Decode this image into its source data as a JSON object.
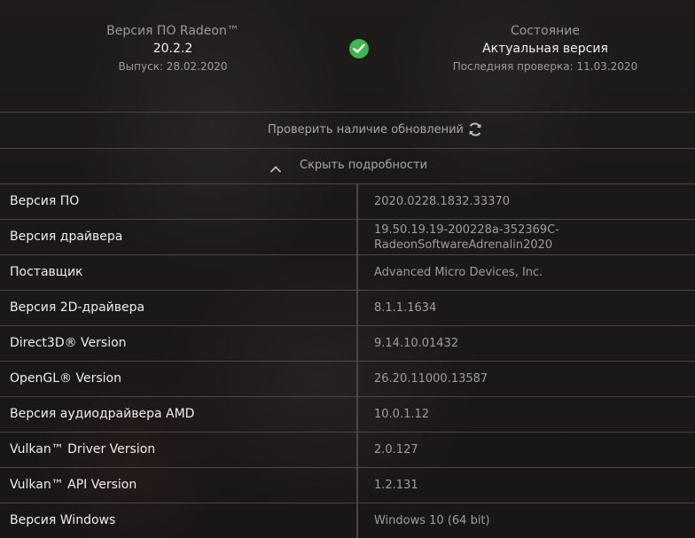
{
  "header": {
    "version_title": "Версия ПО Radeon™",
    "version_number": "20.2.2",
    "release_date": "Выпуск: 28.02.2020",
    "state_title": "Состояние",
    "state_value": "Актуальная версия",
    "last_check": "Последняя проверка: 11.03.2020",
    "status_color": "#3db551"
  },
  "actions": {
    "check_updates_label": "Проверить наличие обновлений",
    "hide_details_label": "Скрыть подробности"
  },
  "details": [
    {
      "key": "Версия ПО",
      "value": "2020.0228.1832.33370"
    },
    {
      "key": "Версия драйвера",
      "value_line1": "19.50.19.19-200228a-352369C-",
      "value_line2": "RadeonSoftwareAdrenalin2020"
    },
    {
      "key": "Поставщик",
      "value": "Advanced Micro Devices, Inc."
    },
    {
      "key": "Версия 2D-драйвера",
      "value": "8.1.1.1634"
    },
    {
      "key": "Direct3D® Version",
      "value": "9.14.10.01432"
    },
    {
      "key": "OpenGL® Version",
      "value": "26.20.11000.13587"
    },
    {
      "key": "Версия аудиодрайвера AMD",
      "value": "10.0.1.12"
    },
    {
      "key": "Vulkan™ Driver Version",
      "value": "2.0.127"
    },
    {
      "key": "Vulkan™ API Version",
      "value": "1.2.131"
    },
    {
      "key": "Версия Windows",
      "value": "Windows 10 (64 bit)"
    }
  ]
}
